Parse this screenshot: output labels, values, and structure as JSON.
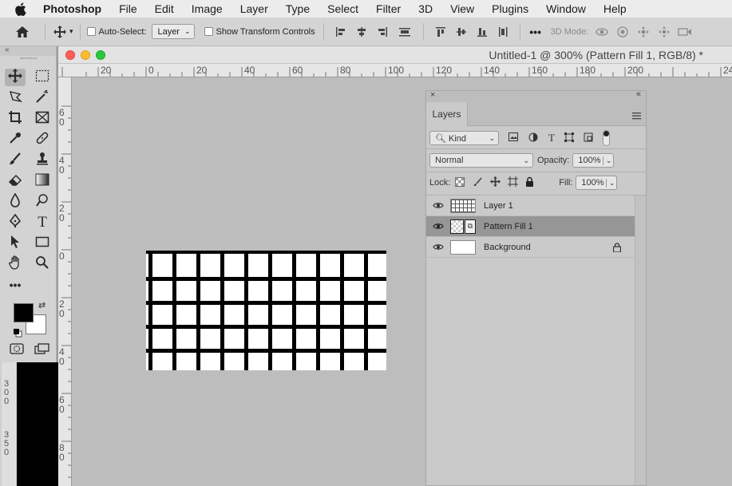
{
  "menubar": {
    "app_name": "Photoshop",
    "items": [
      "File",
      "Edit",
      "Image",
      "Layer",
      "Type",
      "Select",
      "Filter",
      "3D",
      "View",
      "Plugins",
      "Window",
      "Help"
    ]
  },
  "options_bar": {
    "auto_select_label": "Auto-Select:",
    "auto_select_value": "Layer",
    "show_transform_label": "Show Transform Controls",
    "mode_3d_label": "3D Mode:"
  },
  "document": {
    "title": "Untitled-1 @ 300% (Pattern Fill 1, RGB/8) *",
    "ruler_top_labels": [
      "20",
      "0",
      "20",
      "40",
      "60",
      "80",
      "100",
      "120",
      "140",
      "160",
      "180",
      "200",
      "24"
    ],
    "ruler_left_labels": [
      "6\n0",
      "4\n0",
      "2\n0",
      "0",
      "2\n0",
      "4\n0",
      "6\n0",
      "8\n0"
    ],
    "under_tools_ruler_labels": [
      "3\n0\n0",
      "3\n5\n0"
    ]
  },
  "layers_panel": {
    "tab_label": "Layers",
    "filter_kind": "Kind",
    "blend_mode": "Normal",
    "opacity_label": "Opacity:",
    "opacity_value": "100%",
    "lock_label": "Lock:",
    "fill_label": "Fill:",
    "fill_value": "100%",
    "layers": [
      {
        "name": "Layer 1"
      },
      {
        "name": "Pattern Fill 1"
      },
      {
        "name": "Background"
      }
    ]
  },
  "colors": {
    "foreground": "#000000",
    "background": "#ffffff",
    "accent_red": "#ff5f57",
    "accent_yellow": "#febc2e",
    "accent_green": "#28c840"
  }
}
